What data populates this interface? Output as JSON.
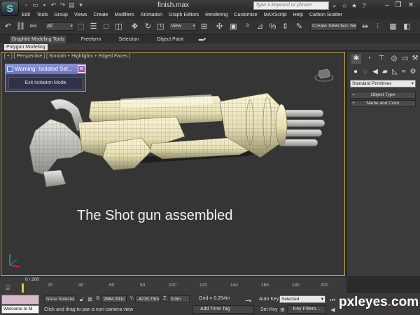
{
  "window": {
    "title": "finish.max",
    "search_placeholder": "Type a keyword or phrase",
    "logo_glyph": "S"
  },
  "menu": [
    "Edit",
    "Tools",
    "Group",
    "Views",
    "Create",
    "Modifiers",
    "Animation",
    "Graph Editors",
    "Rendering",
    "Customize",
    "MAXScript",
    "Help",
    "Carbon Scatter"
  ],
  "toolbar": {
    "selection_filter": "All",
    "reference_coord": "View",
    "named_selection_placeholder": "Create Selection Se"
  },
  "ribbon": {
    "tabs": [
      "Graphite Modeling Tools",
      "Freeform",
      "Selection",
      "Object Paint"
    ],
    "active_tab": "Graphite Modeling Tools",
    "panel_label": "Polygon Modeling"
  },
  "viewport": {
    "label": "[ + ] [ Perspective ] [ Smooth + Highlights + Edged Faces ]",
    "caption": "The Shot gun assembled",
    "border_color": "#c9a34a",
    "model_color": "#f1ecc8"
  },
  "dialog": {
    "title": "Warning: Isolated Sel...",
    "button_label": "Exit Isolation Mode",
    "close_glyph": "✕"
  },
  "command_panel": {
    "dropdown_value": "Standard Primitives",
    "rollouts": [
      "Object Type",
      "Name and Color"
    ]
  },
  "timeline": {
    "readout": "0 / 200",
    "ticks": [
      "20",
      "40",
      "60",
      "80",
      "100",
      "120",
      "140",
      "160",
      "180",
      "200"
    ]
  },
  "status": {
    "welcome": "Welcome to M",
    "selection": "None Selected",
    "coords": [
      {
        "label": "X:",
        "value": "2864.331c"
      },
      {
        "label": "Y:",
        "value": "-4215.73m"
      },
      {
        "label": "Z:",
        "value": "0.0m"
      }
    ],
    "grid": "Grid = 0.254m",
    "prompt": "Click and drag to pan a non-camera view",
    "add_time_tag": "Add Time Tag",
    "auto_key": "Auto Key",
    "set_key": "Set Key",
    "key_mode": "Selected",
    "key_filters": "Key Filters..."
  },
  "watermark": {
    "brand": "pxleyes",
    "dot": ".",
    "tld": "com"
  }
}
